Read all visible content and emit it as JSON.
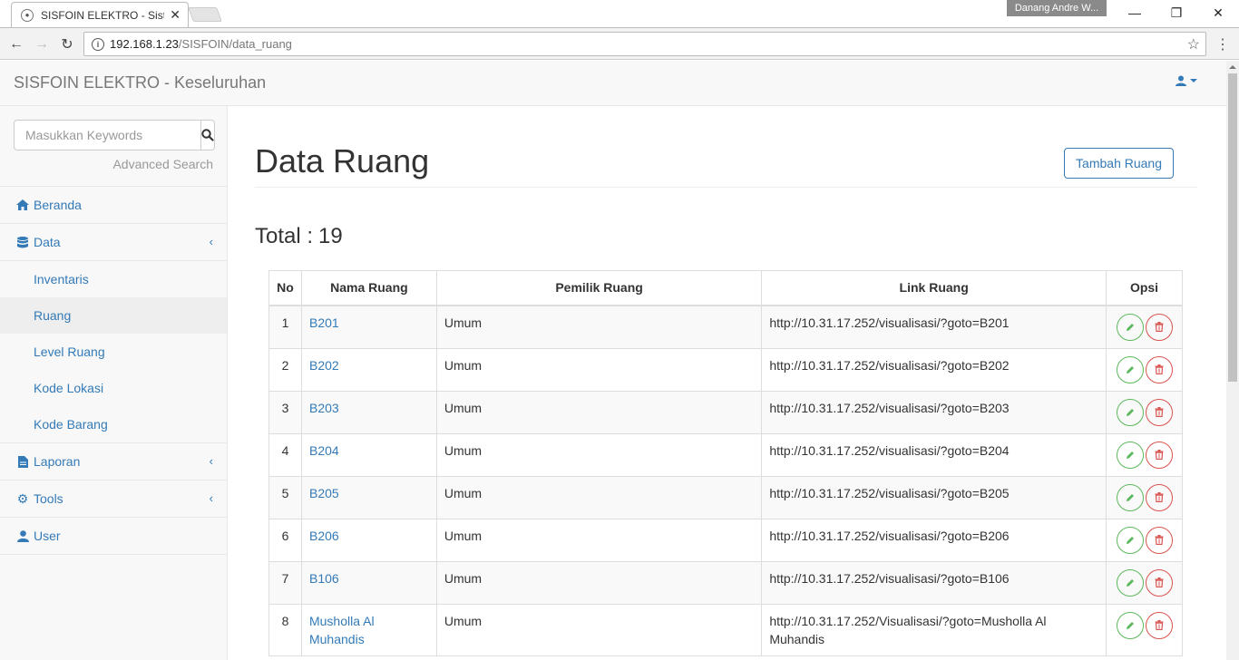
{
  "browser": {
    "tab_title": "SISFOIN ELEKTRO - Siste",
    "profile_name": "Danang Andre W...",
    "url_host": "192.168.1.23",
    "url_path": "/SISFOIN/data_ruang"
  },
  "navbar": {
    "brand": "SISFOIN ELEKTRO - Keseluruhan"
  },
  "sidebar": {
    "search_placeholder": "Masukkan Keywords",
    "advanced_search": "Advanced Search",
    "items": [
      {
        "label": "Beranda",
        "icon": "home-icon"
      },
      {
        "label": "Data",
        "icon": "database-icon"
      },
      {
        "label": "Laporan",
        "icon": "file-icon"
      },
      {
        "label": "Tools",
        "icon": "gear-icon"
      },
      {
        "label": "User",
        "icon": "user-icon"
      }
    ],
    "data_sub": [
      "Inventaris",
      "Ruang",
      "Level Ruang",
      "Kode Lokasi",
      "Kode Barang"
    ],
    "active_sub": "Ruang"
  },
  "main": {
    "title": "Data Ruang",
    "add_button": "Tambah Ruang",
    "total_label": "Total :",
    "total_value": "19"
  },
  "table": {
    "headers": [
      "No",
      "Nama Ruang",
      "Pemilik Ruang",
      "Link Ruang",
      "Opsi"
    ],
    "rows": [
      {
        "no": "1",
        "nama": "B201",
        "pemilik": "Umum",
        "link": "http://10.31.17.252/visualisasi/?goto=B201"
      },
      {
        "no": "2",
        "nama": "B202",
        "pemilik": "Umum",
        "link": "http://10.31.17.252/visualisasi/?goto=B202"
      },
      {
        "no": "3",
        "nama": "B203",
        "pemilik": "Umum",
        "link": "http://10.31.17.252/visualisasi/?goto=B203"
      },
      {
        "no": "4",
        "nama": "B204",
        "pemilik": "Umum",
        "link": "http://10.31.17.252/visualisasi/?goto=B204"
      },
      {
        "no": "5",
        "nama": "B205",
        "pemilik": "Umum",
        "link": "http://10.31.17.252/visualisasi/?goto=B205"
      },
      {
        "no": "6",
        "nama": "B206",
        "pemilik": "Umum",
        "link": "http://10.31.17.252/visualisasi/?goto=B206"
      },
      {
        "no": "7",
        "nama": "B106",
        "pemilik": "Umum",
        "link": "http://10.31.17.252/visualisasi/?goto=B106"
      },
      {
        "no": "8",
        "nama": "Musholla Al Muhandis",
        "pemilik": "Umum",
        "link": "http://10.31.17.252/Visualisasi/?goto=Musholla Al Muhandis"
      }
    ]
  },
  "colors": {
    "link": "#337ab7",
    "edit": "#5cb85c",
    "delete": "#d9534f"
  }
}
